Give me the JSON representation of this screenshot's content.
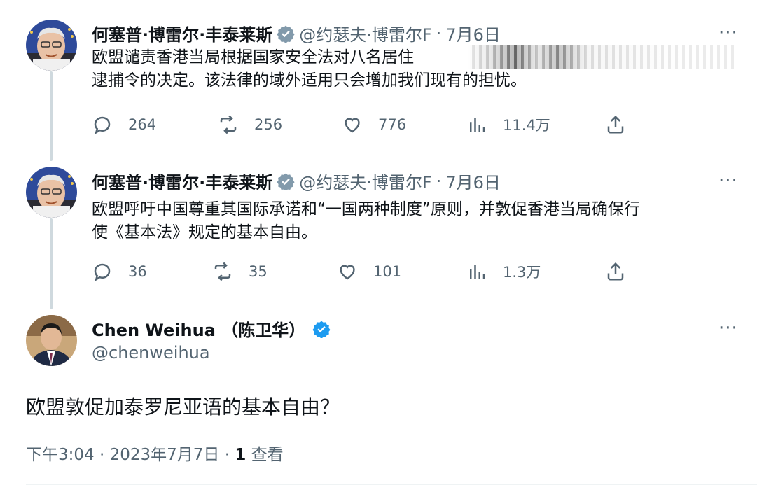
{
  "thread": [
    {
      "author_name": "何塞普·博雷尔·丰泰莱斯",
      "handle": "@约瑟夫·博雷尔F",
      "separator": "·",
      "date": "7月6日",
      "text": "欧盟谴责香港当局根据国家安全法对八名居住",
      "text_line2": "逮捕令的决定。该法律的域外适用只会增加我们现有的担忧。",
      "replies": "264",
      "reposts": "256",
      "likes": "776",
      "views": "11.4万"
    },
    {
      "author_name": "何塞普·博雷尔·丰泰莱斯",
      "handle": "@约瑟夫·博雷尔F",
      "separator": "·",
      "date": "7月6日",
      "text": "欧盟呼吁中国尊重其国际承诺和“一国两种制度”原则，并敦促香港当局确保行",
      "text_line2": "使《基本法》规定的基本自由。",
      "replies": "36",
      "reposts": "35",
      "likes": "101",
      "views": "1.3万"
    }
  ],
  "main_tweet": {
    "author_name": "Chen Weihua （陈卫华）",
    "handle": "@chenweihua",
    "text": "欧盟敦促加泰罗尼亚语的基本自由？",
    "timestamp": "下午3:04 · 2023年7月7日 · ",
    "views_count": "1",
    "views_label": " 查看"
  },
  "more_label": "···",
  "colors": {
    "verified_blue": "#1d9bf0",
    "verified_gray": "#829aab",
    "secondary_text": "#536471",
    "thread_line": "#cfd9de"
  }
}
